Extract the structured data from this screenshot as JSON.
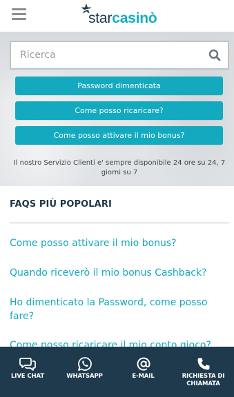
{
  "header": {
    "logo": {
      "word_star": "star",
      "word_casino": "casinò"
    }
  },
  "search": {
    "placeholder": "Ricerca"
  },
  "quick_buttons": [
    {
      "label": "Password dimenticata"
    },
    {
      "label": "Come posso ricaricare?"
    },
    {
      "label": "Come posso attivare il mio bonus?"
    }
  ],
  "service_note": "Il nostro Servizio Clienti e' sempre disponibile 24 ore su 24, 7 giorni su 7",
  "faq": {
    "title": "FAQS PIÙ POPOLARI",
    "items": [
      {
        "label": "Come posso attivare il mio bonus?"
      },
      {
        "label": "Quando riceverò il mio bonus Cashback?"
      },
      {
        "label": "Ho dimenticato la Password, come posso fare?"
      },
      {
        "label": "Come posso ricaricare il mio conto gioco?"
      }
    ]
  },
  "bottom_bar": {
    "items": [
      {
        "label": "LIVE CHAT",
        "icon": "chat-icon"
      },
      {
        "label": "WHATSAPP",
        "icon": "whatsapp-icon"
      },
      {
        "label": "E-MAIL",
        "icon": "at-sign-icon"
      },
      {
        "label": "RICHIESTA DI CHIAMATA",
        "icon": "phone-icon"
      }
    ]
  },
  "colors": {
    "accent": "#13aac0",
    "link": "#15a9bd",
    "navy": "#1f3a4d",
    "title": "#1f3646"
  }
}
